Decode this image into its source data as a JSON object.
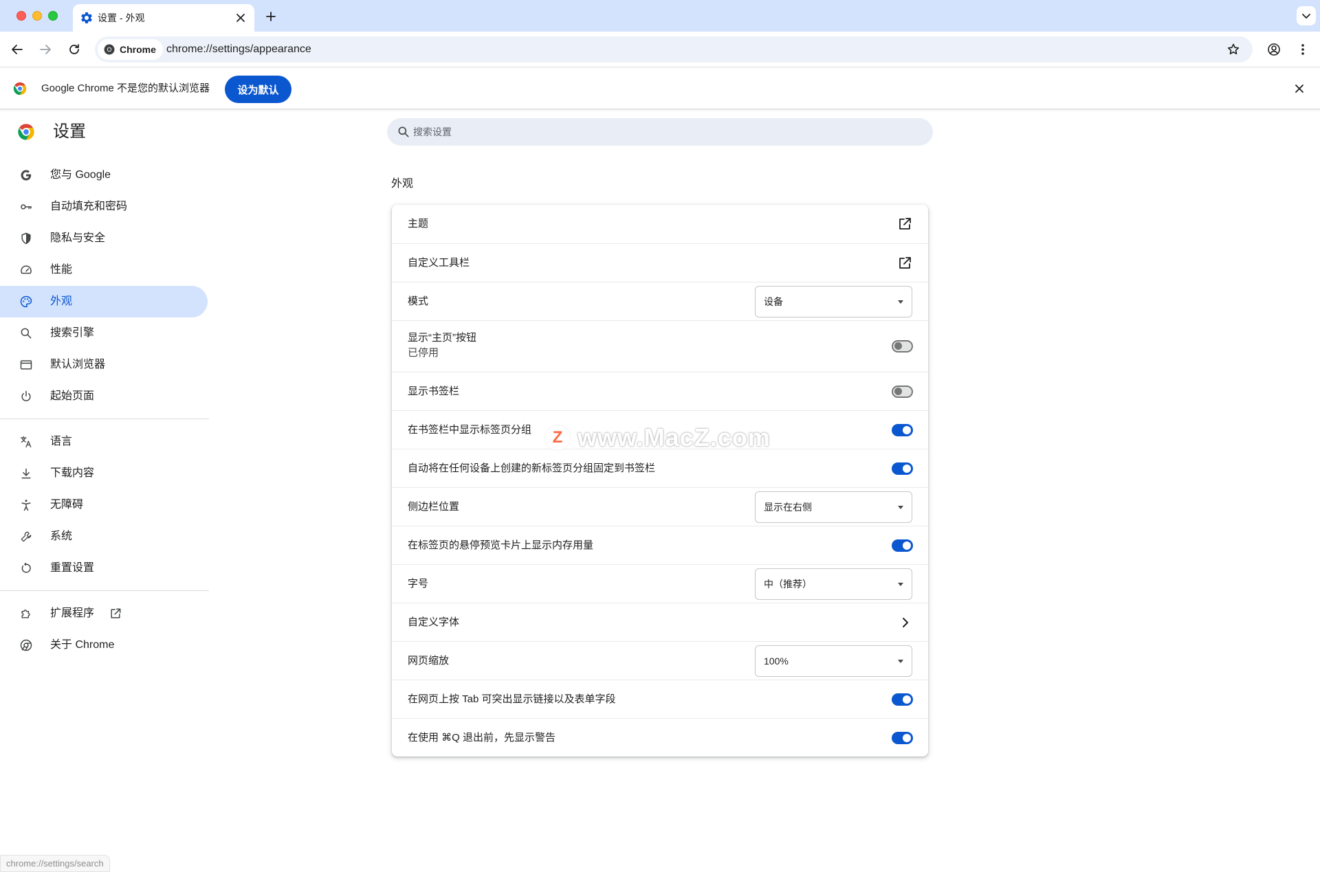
{
  "browser": {
    "tab_title": "设置 - 外观",
    "chip_label": "Chrome",
    "url": "chrome://settings/appearance"
  },
  "infobar": {
    "message": "Google Chrome 不是您的默认浏览器",
    "button_label": "设为默认"
  },
  "header": {
    "title": "设置",
    "search_placeholder": "搜索设置"
  },
  "sidebar": {
    "items": [
      {
        "label": "您与 Google",
        "icon": "google-g-icon"
      },
      {
        "label": "自动填充和密码",
        "icon": "key-icon"
      },
      {
        "label": "隐私与安全",
        "icon": "shield-icon"
      },
      {
        "label": "性能",
        "icon": "speedometer-icon"
      },
      {
        "label": "外观",
        "icon": "palette-icon",
        "active": true
      },
      {
        "label": "搜索引擎",
        "icon": "search-icon"
      },
      {
        "label": "默认浏览器",
        "icon": "browser-window-icon"
      },
      {
        "label": "起始页面",
        "icon": "power-icon"
      },
      {
        "label": "语言",
        "icon": "translate-icon"
      },
      {
        "label": "下载内容",
        "icon": "download-icon"
      },
      {
        "label": "无障碍",
        "icon": "accessibility-icon"
      },
      {
        "label": "系统",
        "icon": "wrench-icon"
      },
      {
        "label": "重置设置",
        "icon": "reset-icon"
      },
      {
        "label": "扩展程序",
        "icon": "puzzle-icon"
      },
      {
        "label": "关于 Chrome",
        "icon": "chrome-logo-icon"
      }
    ]
  },
  "appearance": {
    "section_title": "外观",
    "rows": {
      "theme": "主题",
      "toolbar": "自定义工具栏",
      "mode": "模式",
      "mode_value": "设备",
      "home_button": "显示“主页”按钮",
      "home_button_sub": "已停用",
      "bookmarks_bar": "显示书签栏",
      "tab_groups_in_bookmarks": "在书签栏中显示标签页分组",
      "pin_tab_groups": "自动将在任何设备上创建的新标签页分组固定到书签栏",
      "side_panel": "侧边栏位置",
      "side_panel_value": "显示在右侧",
      "memory_usage": "在标签页的悬停预览卡片上显示内存用量",
      "font_size": "字号",
      "font_size_value": "中（推荐）",
      "custom_fonts": "自定义字体",
      "page_zoom": "网页缩放",
      "page_zoom_value": "100%",
      "tab_highlight": "在网页上按 Tab 可突出显示链接以及表单字段",
      "quit_warning": "在使用 ⌘Q 退出前，先显示警告"
    }
  },
  "watermark": {
    "logo_letter": "Z",
    "text": "www.MacZ.com"
  },
  "status_bar": {
    "text": "chrome://settings/search"
  },
  "colors": {
    "accent": "#0b57d0",
    "active_nav_bg": "#d3e3fd",
    "tabstrip_bg": "#d3e3fd",
    "omnibox_bg": "#edf2fa"
  }
}
